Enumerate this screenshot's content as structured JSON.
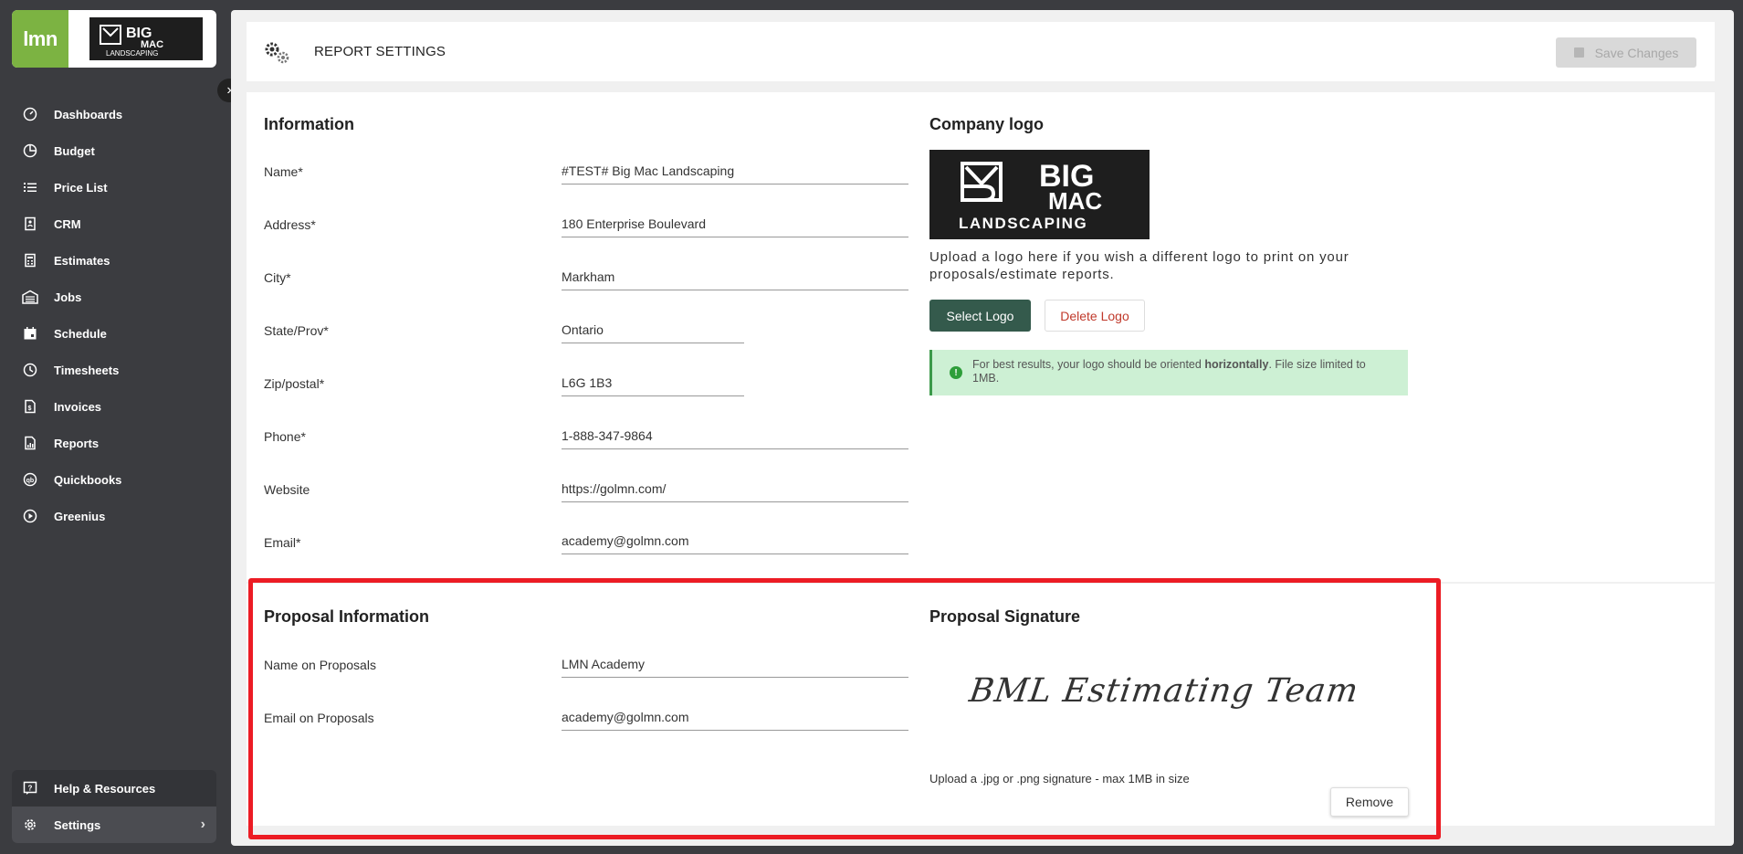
{
  "brand": {
    "lmn_logo_text": "lmn",
    "company_logo_lines": [
      "BIG",
      "MAC",
      "LANDSCAPING"
    ]
  },
  "sidebar": {
    "items": [
      {
        "label": "Dashboards",
        "icon": "dashboard-icon"
      },
      {
        "label": "Budget",
        "icon": "pie-chart-icon"
      },
      {
        "label": "Price List",
        "icon": "list-icon"
      },
      {
        "label": "CRM",
        "icon": "contacts-icon"
      },
      {
        "label": "Estimates",
        "icon": "calculator-icon"
      },
      {
        "label": "Jobs",
        "icon": "garage-icon"
      },
      {
        "label": "Schedule",
        "icon": "calendar-icon"
      },
      {
        "label": "Timesheets",
        "icon": "clock-icon"
      },
      {
        "label": "Invoices",
        "icon": "invoice-icon"
      },
      {
        "label": "Reports",
        "icon": "report-icon"
      },
      {
        "label": "Quickbooks",
        "icon": "quickbooks-icon"
      },
      {
        "label": "Greenius",
        "icon": "play-icon"
      }
    ],
    "bottom": [
      {
        "label": "Help & Resources",
        "icon": "help-icon"
      },
      {
        "label": "Settings",
        "icon": "gear-icon",
        "active": true
      }
    ]
  },
  "header": {
    "title": "REPORT SETTINGS",
    "save_label": "Save Changes"
  },
  "information": {
    "title": "Information",
    "fields": [
      {
        "label": "Name*",
        "value": "#TEST# Big Mac Landscaping"
      },
      {
        "label": "Address*",
        "value": "180 Enterprise Boulevard"
      },
      {
        "label": "City*",
        "value": "Markham"
      },
      {
        "label": "State/Prov*",
        "value": "Ontario"
      },
      {
        "label": "Zip/postal*",
        "value": "L6G 1B3"
      },
      {
        "label": "Phone*",
        "value": "1-888-347-9864"
      },
      {
        "label": "Website",
        "value": "https://golmn.com/"
      },
      {
        "label": "Email*",
        "value": "academy@golmn.com"
      }
    ]
  },
  "company_logo": {
    "title": "Company logo",
    "upload_text": "Upload a logo here if you wish a different logo to print on your proposals/estimate reports.",
    "select_label": "Select Logo",
    "delete_label": "Delete Logo",
    "notice_prefix": "For best results, your logo should be oriented ",
    "notice_bold": "horizontally",
    "notice_suffix": ". File size limited to 1MB."
  },
  "proposal_information": {
    "title": "Proposal Information",
    "fields": [
      {
        "label": "Name on Proposals",
        "value": "LMN Academy"
      },
      {
        "label": "Email on Proposals",
        "value": "academy@golmn.com"
      }
    ]
  },
  "proposal_signature": {
    "title": "Proposal Signature",
    "signature_text": "BML Estimating Team",
    "hint": "Upload a .jpg or .png signature - max 1MB in size",
    "remove_label": "Remove"
  },
  "colors": {
    "sidebar_bg": "#3b3c40",
    "accent_green": "#345a4c",
    "lmn_green": "#7cb342",
    "highlight_red": "#ec1c24",
    "notice_bg": "#cdf0d4"
  }
}
